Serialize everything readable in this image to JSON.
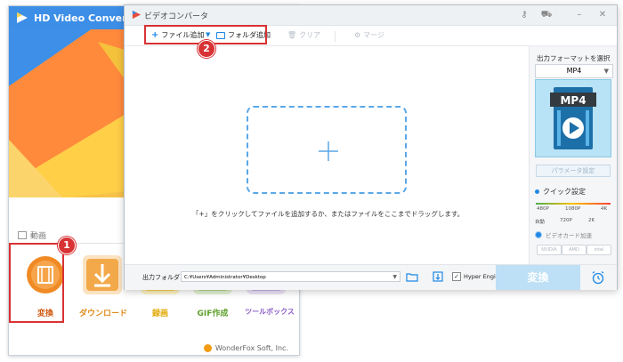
{
  "launcher": {
    "app_title": "HD Video Converter Factory",
    "section_label": "動画",
    "tiles": [
      {
        "label": "変換",
        "color": "#f08a24"
      },
      {
        "label": "ダウンロード",
        "color": "#f3a94a"
      },
      {
        "label": "録画",
        "color": "#ffc93c"
      },
      {
        "label": "GIF作成",
        "color": "#8bc34a"
      },
      {
        "label": "ツールボックス",
        "color": "#9a6fd0"
      }
    ],
    "footer": "WonderFox Soft, Inc."
  },
  "steps": {
    "one": "1",
    "two": "2"
  },
  "converter": {
    "title": "ビデオコンバータ",
    "toolbar": {
      "add_file": "ファイル追加",
      "add_folder": "フォルダ追加",
      "clear": "クリア",
      "merge": "マージ"
    },
    "drop_hint": "「+」をクリックしてファイルを追加するか、またはファイルをここまでドラッグします。",
    "panel": {
      "heading": "出力フォーマットを選択",
      "format": "MP4",
      "format_badge": "MP4",
      "param_button": "パラメータ設定",
      "quick_label": "クイック設定",
      "quality_top": [
        "480P",
        "1080P",
        "4K"
      ],
      "quality_bottom": [
        "自動",
        "720P",
        "2K"
      ],
      "gpu_label": "ビデオカード加速",
      "vendors": [
        "NVIDIA",
        "AMD",
        "intel"
      ]
    },
    "bottom": {
      "output_label": "出力フォルダ：",
      "output_path": "C:¥Users¥Administrator¥Desktop",
      "hyper_engine": "Hyper Engine",
      "hyper_checked": true,
      "convert": "変換"
    }
  },
  "colors": {
    "accent": "#1e88e5",
    "highlight": "#d83234",
    "convert_button": "#bde0f6"
  }
}
